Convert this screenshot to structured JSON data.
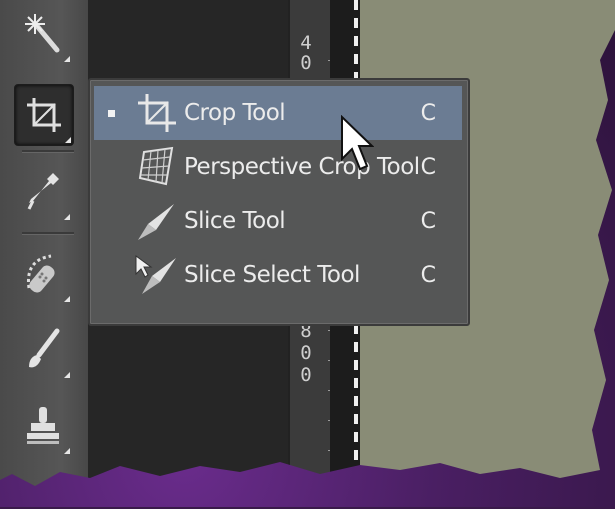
{
  "menu": {
    "items": [
      {
        "label": "Crop Tool",
        "shortcut": "C",
        "icon": "crop-icon",
        "selected": true
      },
      {
        "label": "Perspective Crop Tool",
        "shortcut": "C",
        "icon": "perspective-crop-icon",
        "selected": false
      },
      {
        "label": "Slice Tool",
        "shortcut": "C",
        "icon": "slice-icon",
        "selected": false
      },
      {
        "label": "Slice Select Tool",
        "shortcut": "C",
        "icon": "slice-select-icon",
        "selected": false
      }
    ]
  },
  "toolbar": {
    "tools": [
      "magic-wand-icon",
      "crop-icon",
      "eyedropper-icon",
      "healing-brush-icon",
      "brush-icon",
      "clone-stamp-icon"
    ]
  },
  "ruler": {
    "top_digits": [
      "4",
      "0"
    ],
    "bottom_digits": [
      "8",
      "0",
      "0"
    ]
  },
  "colors": {
    "selection": "#6b7c93",
    "menu_bg": "#555656",
    "document": "#898c76"
  }
}
